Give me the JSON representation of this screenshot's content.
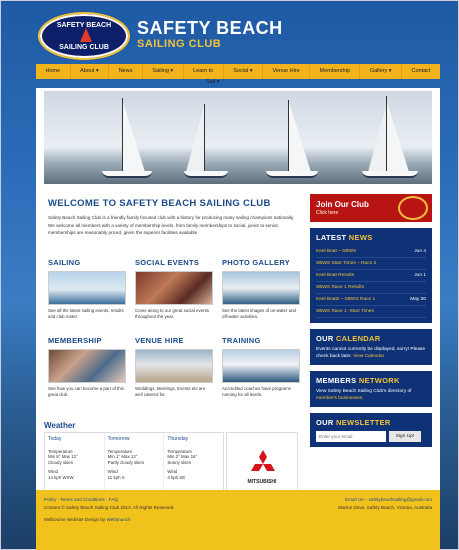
{
  "header": {
    "logo_top": "SAFETY BEACH",
    "logo_bottom": "SAILING CLUB",
    "title": "SAFETY BEACH",
    "subtitle": "SAILING CLUB"
  },
  "nav": [
    "Home",
    "About ▾",
    "News",
    "Sailing ▾",
    "Learn to",
    "Social ▾",
    "Venue Hire",
    "Membership",
    "Gallery ▾",
    "Contact"
  ],
  "nav_wrap": "Sail ▾",
  "welcome": {
    "prefix": "WELCOME TO ",
    "name": "SAFETY BEACH SAILING CLUB",
    "text": "Safety Beach Sailing Club is a friendly family focused club with a history for producing many sailing champions nationally. We welcome all members with a variety of membership levels, from family memberships to social, junior to senior, memberships are reasonably priced, given the superior facilities available"
  },
  "cards": [
    {
      "title": "SAILING",
      "text": "See all the latest sailing events, results and club roster."
    },
    {
      "title": "SOCIAL EVENTS",
      "text": "Come along to our great social events throughout the year."
    },
    {
      "title": "PHOTO GALLERY",
      "text": "See the latest images of on-water and off-water activities."
    },
    {
      "title": "MEMBERSHIP",
      "text": "See how you can become a part of this great club."
    },
    {
      "title": "VENUE HIRE",
      "text": "Weddings, Meetings, Events etc are well catered for."
    },
    {
      "title": "TRAINING",
      "text": "Accredited coaches have programs running for all levels."
    }
  ],
  "weather": {
    "heading": "Weather",
    "days": [
      {
        "day": "Today",
        "temp_label": "Temperature",
        "temp": "Min 8° Max 12°",
        "cond": "Cloudy skies",
        "wind_label": "Wind",
        "wind": "14 kph WSW"
      },
      {
        "day": "Tomorrow",
        "temp_label": "Temperature",
        "temp": "Min 1° Max 12°",
        "cond": "Partly cloudy skies",
        "wind_label": "Wind",
        "wind": "11 kph S"
      },
      {
        "day": "Thursday",
        "temp_label": "Temperature",
        "temp": "Min 2° Max 16°",
        "cond": "Sunny skies",
        "wind_label": "Wind",
        "wind": "4 kph SE"
      }
    ]
  },
  "sponsor": {
    "name": "MITSUBISHI"
  },
  "join": {
    "title": "Join Our Club",
    "link": "Click here"
  },
  "latest_news": {
    "heading_a": "LATEST ",
    "heading_b": "NEWS",
    "items": [
      {
        "title": "Keel Boat – SBWS",
        "date": "Jun 4"
      },
      {
        "title": "SBWS Start Times – Race 2",
        "date": ""
      },
      {
        "title": "Keel Boat Results",
        "date": "Jun 1"
      },
      {
        "title": "SBWS Race 1 Results",
        "date": ""
      },
      {
        "title": "Keel Boats – SBWS Race 1",
        "date": "May 30"
      },
      {
        "title": "SBWS Race 1 -Start Times",
        "date": ""
      }
    ]
  },
  "calendar": {
    "heading_a": "OUR ",
    "heading_b": "CALENDAR",
    "text": "Events cannot currently be displayed, sorry! Please check back later.",
    "link": "View Calendar"
  },
  "members": {
    "heading_a": "MEMBERS ",
    "heading_b": "NETWORK",
    "text": "View Safety Beach Sailing Club's directory of ",
    "link": "member's businesses."
  },
  "newsletter": {
    "heading_a": "OUR ",
    "heading_b": "NEWSLETTER",
    "placeholder": "Enter your email",
    "button": "Sign Up!"
  },
  "footer": {
    "links": "Policy · Terms and Conditions · FAQ",
    "copyright": "Content © Safety Beach Sailing Club 2013. All Rights Reserved.",
    "credit_prefix": "Melbourne Website Design by ",
    "credit_link": "Websnunch",
    "email": "Email Us – safetybeachsailing@gmail.com",
    "address": "Marine Drive, Safety Beach, Victoria, Australia"
  },
  "colors": {
    "accent": "#f2b31c",
    "navy": "#0f3175",
    "heading_blue": "#1a4a8a",
    "join_red": "#b81414"
  }
}
